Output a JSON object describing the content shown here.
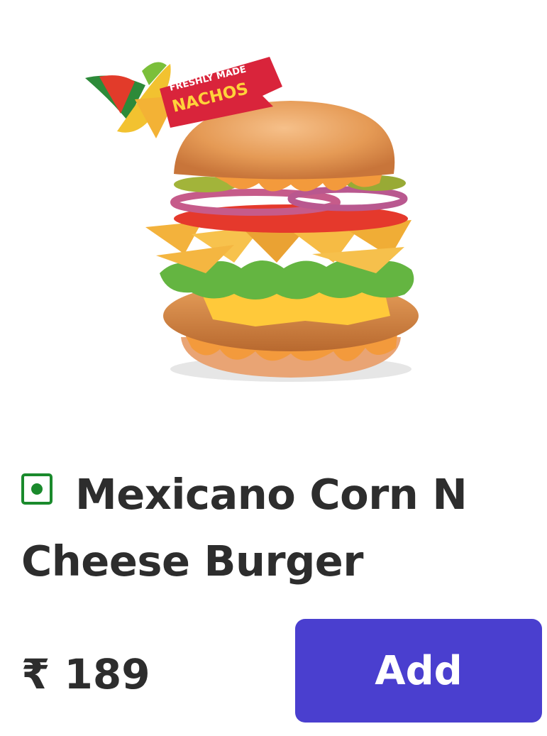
{
  "product": {
    "badge_line1": "FRESHLY MADE",
    "badge_line2": "NACHOS",
    "diet_indicator": "veg-icon",
    "name": "Mexicano Corn N Cheese Burger",
    "price": "₹ 189",
    "add_label": "Add",
    "colors": {
      "veg": "#1a8a2c",
      "button": "#4a3fcf",
      "text": "#2d2d2d"
    }
  }
}
